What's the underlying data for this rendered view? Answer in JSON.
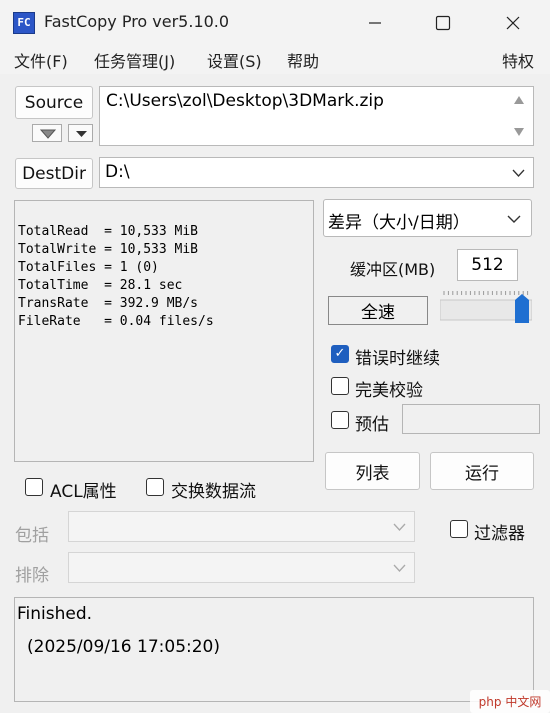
{
  "window": {
    "title": "FastCopy Pro ver5.10.0",
    "icon_text": "FC"
  },
  "menu": {
    "file": "文件(F)",
    "tasks": "任务管理(J)",
    "settings": "设置(S)",
    "help": "帮助",
    "privilege": "特权"
  },
  "source": {
    "button": "Source",
    "path": "C:\\Users\\zol\\Desktop\\3DMark.zip"
  },
  "dest": {
    "button": "DestDir",
    "path": "D:\\"
  },
  "stats": [
    "TotalRead  = 10,533 MiB",
    "TotalWrite = 10,533 MiB",
    "TotalFiles = 1 (0)",
    "TotalTime  = 28.1 sec",
    "TransRate  = 392.9 MB/s",
    "FileRate   = 0.04 files/s"
  ],
  "mode": {
    "selected": "差异（大小/日期）"
  },
  "buffer": {
    "label": "缓冲区(MB)",
    "value": "512"
  },
  "speed": {
    "label": "全速",
    "level": 1.0
  },
  "options": {
    "continue_on_error": {
      "label": "错误时继续",
      "checked": true
    },
    "verify": {
      "label": "完美校验",
      "checked": false
    },
    "estimate": {
      "label": "预估",
      "checked": false
    }
  },
  "actions": {
    "list": "列表",
    "run": "运行"
  },
  "flags": {
    "acl": "ACL属性",
    "streams": "交换数据流",
    "filter": "过滤器"
  },
  "filters": {
    "include": "包括",
    "exclude": "排除"
  },
  "status": {
    "line1": "Finished.",
    "line2": "(2025/09/16 17:05:20)"
  },
  "watermark": "php 中文网",
  "colors": {
    "accent": "#1f5fbf"
  }
}
